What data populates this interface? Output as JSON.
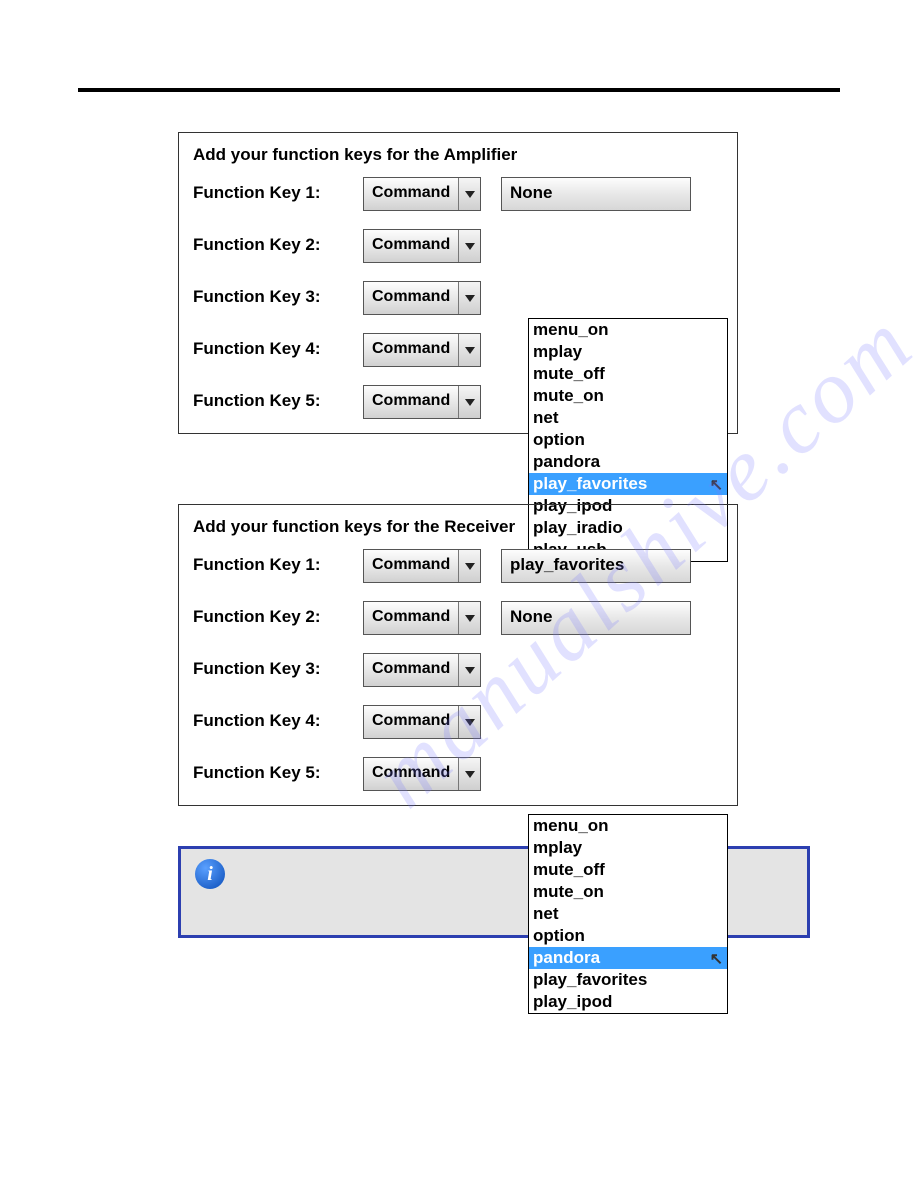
{
  "watermark": "manualshive.com",
  "panel1": {
    "title": "Add your function keys for the Amplifier",
    "rows": [
      {
        "label": "Function Key 1:"
      },
      {
        "label": "Function Key 2:"
      },
      {
        "label": "Function Key 3:"
      },
      {
        "label": "Function Key 4:"
      },
      {
        "label": "Function Key 5:"
      }
    ],
    "dropdown_label": "Command",
    "value1": "None",
    "listbox_top": "230",
    "options": [
      {
        "text": "menu_on",
        "sel": false
      },
      {
        "text": "mplay",
        "sel": false
      },
      {
        "text": "mute_off",
        "sel": false
      },
      {
        "text": "mute_on",
        "sel": false
      },
      {
        "text": "net",
        "sel": false
      },
      {
        "text": "option",
        "sel": false
      },
      {
        "text": "pandora",
        "sel": false
      },
      {
        "text": "play_favorites",
        "sel": true
      },
      {
        "text": "play_ipod",
        "sel": false
      },
      {
        "text": "play_iradio",
        "sel": false
      },
      {
        "text": "play_usb",
        "sel": false
      }
    ]
  },
  "panel2": {
    "title": "Add your function keys for the Receiver",
    "rows": [
      {
        "label": "Function Key 1:"
      },
      {
        "label": "Function Key 2:"
      },
      {
        "label": "Function Key 3:"
      },
      {
        "label": "Function Key 4:"
      },
      {
        "label": "Function Key 5:"
      }
    ],
    "dropdown_label": "Command",
    "value1": "play_favorites",
    "value2": "None",
    "listbox_top": "726",
    "options": [
      {
        "text": "menu_on",
        "sel": false
      },
      {
        "text": "mplay",
        "sel": false
      },
      {
        "text": "mute_off",
        "sel": false
      },
      {
        "text": "mute_on",
        "sel": false
      },
      {
        "text": "net",
        "sel": false
      },
      {
        "text": "option",
        "sel": false
      },
      {
        "text": "pandora",
        "sel": true
      },
      {
        "text": "play_favorites",
        "sel": false
      },
      {
        "text": "play_ipod",
        "sel": false
      }
    ]
  },
  "info_icon_char": "i"
}
